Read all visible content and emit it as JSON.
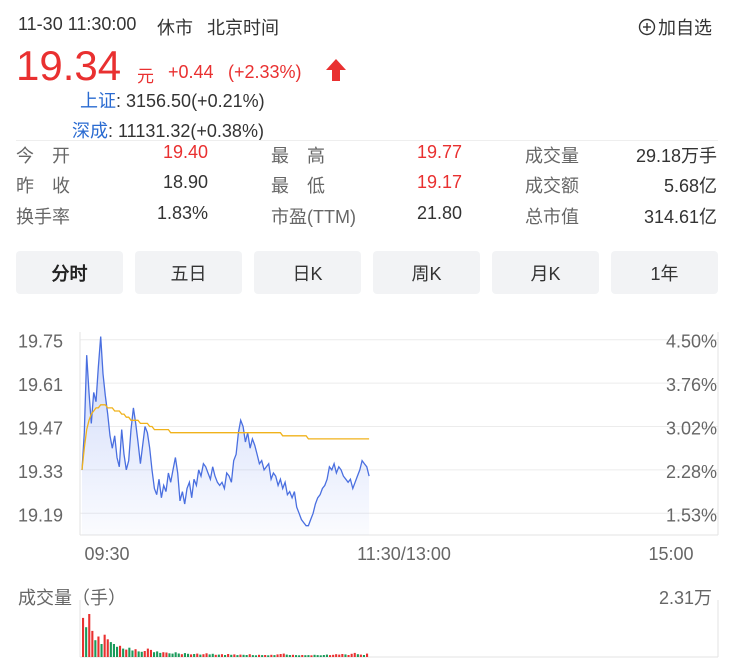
{
  "header": {
    "datetime": "11-30 11:30:00",
    "status": "休市",
    "timezone": "北京时间",
    "add_label": "加自选"
  },
  "quote": {
    "price": "19.34",
    "unit": "元",
    "change": "+0.44",
    "change_pct": "(+2.33%)",
    "direction_icon": "arrow-up-icon",
    "up_color": "#e93030"
  },
  "indices": [
    {
      "name": "上证",
      "value": ": 3156.50(+0.21%)"
    },
    {
      "name": "深成",
      "value": ": 11131.32(+0.38%)"
    }
  ],
  "stats": [
    [
      {
        "label": "今　开",
        "value": "19.40",
        "color": "red"
      },
      {
        "label": "最　高",
        "value": "19.77",
        "color": "red"
      },
      {
        "label": "成交量",
        "value": "29.18万手",
        "color": "dark"
      }
    ],
    [
      {
        "label": "昨　收",
        "value": "18.90",
        "color": "dark"
      },
      {
        "label": "最　低",
        "value": "19.17",
        "color": "red"
      },
      {
        "label": "成交额",
        "value": "5.68亿",
        "color": "dark"
      }
    ],
    [
      {
        "label": "换手率",
        "value": "1.83%",
        "color": "dark"
      },
      {
        "label": "市盈(TTM)",
        "value": "21.80",
        "color": "dark"
      },
      {
        "label": "总市值",
        "value": "314.61亿",
        "color": "dark"
      }
    ]
  ],
  "tabs": [
    {
      "label": "分时",
      "active": true
    },
    {
      "label": "五日",
      "active": false
    },
    {
      "label": "日K",
      "active": false
    },
    {
      "label": "周K",
      "active": false
    },
    {
      "label": "月K",
      "active": false
    },
    {
      "label": "1年",
      "active": false
    }
  ],
  "chart_data": {
    "type": "line",
    "y_left_labels": [
      "19.75",
      "19.61",
      "19.47",
      "19.33",
      "19.19"
    ],
    "y_right_labels": [
      "4.50%",
      "3.76%",
      "3.02%",
      "2.28%",
      "1.53%"
    ],
    "x_labels": [
      "09:30",
      "11:30/13:00",
      "15:00"
    ],
    "ylim": [
      19.12,
      19.82
    ],
    "session_fraction_elapsed": 0.5,
    "series": [
      {
        "role": "price",
        "color": "#4a6fe0",
        "values": [
          19.33,
          19.45,
          19.7,
          19.58,
          19.48,
          19.58,
          19.55,
          19.66,
          19.76,
          19.64,
          19.57,
          19.51,
          19.44,
          19.4,
          19.44,
          19.37,
          19.34,
          19.46,
          19.38,
          19.33,
          19.36,
          19.46,
          19.53,
          19.48,
          19.42,
          19.35,
          19.41,
          19.47,
          19.45,
          19.4,
          19.33,
          19.27,
          19.25,
          19.3,
          19.24,
          19.28,
          19.26,
          19.32,
          19.29,
          19.33,
          19.37,
          19.32,
          19.23,
          19.26,
          19.22,
          19.27,
          19.29,
          19.24,
          19.3,
          19.28,
          19.33,
          19.31,
          19.35,
          19.34,
          19.32,
          19.3,
          19.34,
          19.31,
          19.29,
          19.28,
          19.29,
          19.27,
          19.32,
          19.31,
          19.29,
          19.36,
          19.38,
          19.45,
          19.49,
          19.47,
          19.42,
          19.45,
          19.4,
          19.43,
          19.41,
          19.38,
          19.35,
          19.36,
          19.33,
          19.34,
          19.35,
          19.3,
          19.32,
          19.31,
          19.28,
          19.3,
          19.27,
          19.29,
          19.25,
          19.26,
          19.24,
          19.26,
          19.21,
          19.19,
          19.17,
          19.16,
          19.15,
          19.15,
          19.17,
          19.19,
          19.22,
          19.24,
          19.25,
          19.27,
          19.28,
          19.3,
          19.34,
          19.33,
          19.35,
          19.32,
          19.34,
          19.33,
          19.31,
          19.3,
          19.29,
          19.3,
          19.27,
          19.29,
          19.31,
          19.33,
          19.36,
          19.35,
          19.34,
          19.31
        ]
      },
      {
        "role": "average",
        "color": "#f0b21b",
        "values": [
          19.33,
          19.4,
          19.46,
          19.49,
          19.51,
          19.52,
          19.53,
          19.53,
          19.54,
          19.54,
          19.54,
          19.53,
          19.53,
          19.53,
          19.52,
          19.52,
          19.52,
          19.51,
          19.51,
          19.5,
          19.5,
          19.49,
          19.49,
          19.49,
          19.49,
          19.48,
          19.48,
          19.48,
          19.48,
          19.47,
          19.47,
          19.46,
          19.46,
          19.46,
          19.46,
          19.46,
          19.46,
          19.46,
          19.45,
          19.45,
          19.45,
          19.45,
          19.45,
          19.45,
          19.45,
          19.45,
          19.45,
          19.45,
          19.45,
          19.45,
          19.45,
          19.45,
          19.45,
          19.45,
          19.45,
          19.45,
          19.45,
          19.45,
          19.45,
          19.45,
          19.45,
          19.45,
          19.45,
          19.45,
          19.45,
          19.45,
          19.45,
          19.45,
          19.45,
          19.45,
          19.45,
          19.45,
          19.45,
          19.45,
          19.45,
          19.45,
          19.45,
          19.45,
          19.45,
          19.45,
          19.45,
          19.45,
          19.45,
          19.45,
          19.45,
          19.45,
          19.44,
          19.44,
          19.44,
          19.44,
          19.44,
          19.44,
          19.44,
          19.44,
          19.44,
          19.44,
          19.44,
          19.43,
          19.43,
          19.43,
          19.43,
          19.43,
          19.43,
          19.43,
          19.43,
          19.43,
          19.43,
          19.43,
          19.43,
          19.43,
          19.43,
          19.43,
          19.43,
          19.43,
          19.43,
          19.43,
          19.43,
          19.43,
          19.43,
          19.43,
          19.43,
          19.43,
          19.43,
          19.43
        ]
      }
    ]
  },
  "volume": {
    "title": "成交量（手）",
    "max_label": "2.31万",
    "max_value": 23100,
    "up_color": "#e93030",
    "down_color": "#1a9a5a",
    "bars": [
      {
        "v": 21000,
        "up": true
      },
      {
        "v": 16000,
        "up": false
      },
      {
        "v": 23100,
        "up": true
      },
      {
        "v": 14000,
        "up": true
      },
      {
        "v": 9000,
        "up": false
      },
      {
        "v": 11000,
        "up": true
      },
      {
        "v": 7000,
        "up": false
      },
      {
        "v": 12000,
        "up": true
      },
      {
        "v": 9500,
        "up": true
      },
      {
        "v": 8000,
        "up": false
      },
      {
        "v": 7000,
        "up": false
      },
      {
        "v": 5500,
        "up": false
      },
      {
        "v": 6000,
        "up": true
      },
      {
        "v": 4500,
        "up": false
      },
      {
        "v": 4000,
        "up": true
      },
      {
        "v": 5000,
        "up": false
      },
      {
        "v": 3500,
        "up": false
      },
      {
        "v": 4200,
        "up": true
      },
      {
        "v": 3000,
        "up": false
      },
      {
        "v": 2800,
        "up": false
      },
      {
        "v": 3200,
        "up": true
      },
      {
        "v": 4500,
        "up": true
      },
      {
        "v": 3800,
        "up": true
      },
      {
        "v": 2600,
        "up": false
      },
      {
        "v": 3000,
        "up": false
      },
      {
        "v": 2200,
        "up": false
      },
      {
        "v": 2600,
        "up": true
      },
      {
        "v": 2400,
        "up": true
      },
      {
        "v": 2000,
        "up": false
      },
      {
        "v": 1800,
        "up": false
      },
      {
        "v": 2500,
        "up": false
      },
      {
        "v": 1900,
        "up": false
      },
      {
        "v": 1500,
        "up": true
      },
      {
        "v": 2100,
        "up": false
      },
      {
        "v": 1700,
        "up": false
      },
      {
        "v": 1400,
        "up": true
      },
      {
        "v": 1600,
        "up": false
      },
      {
        "v": 1800,
        "up": true
      },
      {
        "v": 1300,
        "up": false
      },
      {
        "v": 1500,
        "up": true
      },
      {
        "v": 2000,
        "up": true
      },
      {
        "v": 1400,
        "up": false
      },
      {
        "v": 1700,
        "up": false
      },
      {
        "v": 1200,
        "up": true
      },
      {
        "v": 1300,
        "up": false
      },
      {
        "v": 1500,
        "up": true
      },
      {
        "v": 1100,
        "up": false
      },
      {
        "v": 1600,
        "up": true
      },
      {
        "v": 1200,
        "up": false
      },
      {
        "v": 1400,
        "up": true
      },
      {
        "v": 1000,
        "up": false
      },
      {
        "v": 1300,
        "up": true
      },
      {
        "v": 1200,
        "up": false
      },
      {
        "v": 1100,
        "up": false
      },
      {
        "v": 1500,
        "up": true
      },
      {
        "v": 1000,
        "up": false
      },
      {
        "v": 900,
        "up": false
      },
      {
        "v": 1200,
        "up": true
      },
      {
        "v": 1000,
        "up": false
      },
      {
        "v": 1100,
        "up": true
      },
      {
        "v": 900,
        "up": false
      },
      {
        "v": 1200,
        "up": true
      },
      {
        "v": 1000,
        "up": false
      },
      {
        "v": 1400,
        "up": true
      },
      {
        "v": 1600,
        "up": true
      },
      {
        "v": 1800,
        "up": true
      },
      {
        "v": 1300,
        "up": false
      },
      {
        "v": 1100,
        "up": false
      },
      {
        "v": 1200,
        "up": true
      },
      {
        "v": 1000,
        "up": false
      },
      {
        "v": 900,
        "up": false
      },
      {
        "v": 1100,
        "up": true
      },
      {
        "v": 950,
        "up": false
      },
      {
        "v": 1000,
        "up": false
      },
      {
        "v": 900,
        "up": true
      },
      {
        "v": 1200,
        "up": false
      },
      {
        "v": 1000,
        "up": false
      },
      {
        "v": 900,
        "up": false
      },
      {
        "v": 1100,
        "up": false
      },
      {
        "v": 1300,
        "up": false
      },
      {
        "v": 1000,
        "up": true
      },
      {
        "v": 1200,
        "up": true
      },
      {
        "v": 1500,
        "up": true
      },
      {
        "v": 1300,
        "up": true
      },
      {
        "v": 1600,
        "up": true
      },
      {
        "v": 1400,
        "up": false
      },
      {
        "v": 1100,
        "up": true
      },
      {
        "v": 1700,
        "up": true
      },
      {
        "v": 2200,
        "up": true
      },
      {
        "v": 1500,
        "up": false
      },
      {
        "v": 1300,
        "up": true
      },
      {
        "v": 1100,
        "up": false
      },
      {
        "v": 1800,
        "up": true
      }
    ]
  }
}
